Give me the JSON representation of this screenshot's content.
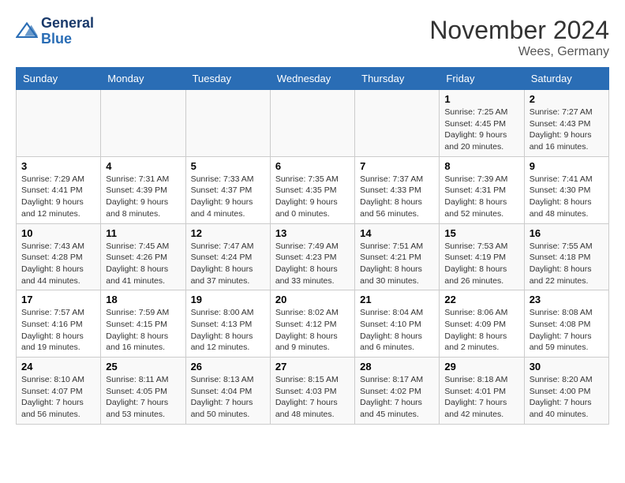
{
  "header": {
    "logo_line1": "General",
    "logo_line2": "Blue",
    "month": "November 2024",
    "location": "Wees, Germany"
  },
  "days_of_week": [
    "Sunday",
    "Monday",
    "Tuesday",
    "Wednesday",
    "Thursday",
    "Friday",
    "Saturday"
  ],
  "weeks": [
    [
      {
        "num": "",
        "info": ""
      },
      {
        "num": "",
        "info": ""
      },
      {
        "num": "",
        "info": ""
      },
      {
        "num": "",
        "info": ""
      },
      {
        "num": "",
        "info": ""
      },
      {
        "num": "1",
        "info": "Sunrise: 7:25 AM\nSunset: 4:45 PM\nDaylight: 9 hours and 20 minutes."
      },
      {
        "num": "2",
        "info": "Sunrise: 7:27 AM\nSunset: 4:43 PM\nDaylight: 9 hours and 16 minutes."
      }
    ],
    [
      {
        "num": "3",
        "info": "Sunrise: 7:29 AM\nSunset: 4:41 PM\nDaylight: 9 hours and 12 minutes."
      },
      {
        "num": "4",
        "info": "Sunrise: 7:31 AM\nSunset: 4:39 PM\nDaylight: 9 hours and 8 minutes."
      },
      {
        "num": "5",
        "info": "Sunrise: 7:33 AM\nSunset: 4:37 PM\nDaylight: 9 hours and 4 minutes."
      },
      {
        "num": "6",
        "info": "Sunrise: 7:35 AM\nSunset: 4:35 PM\nDaylight: 9 hours and 0 minutes."
      },
      {
        "num": "7",
        "info": "Sunrise: 7:37 AM\nSunset: 4:33 PM\nDaylight: 8 hours and 56 minutes."
      },
      {
        "num": "8",
        "info": "Sunrise: 7:39 AM\nSunset: 4:31 PM\nDaylight: 8 hours and 52 minutes."
      },
      {
        "num": "9",
        "info": "Sunrise: 7:41 AM\nSunset: 4:30 PM\nDaylight: 8 hours and 48 minutes."
      }
    ],
    [
      {
        "num": "10",
        "info": "Sunrise: 7:43 AM\nSunset: 4:28 PM\nDaylight: 8 hours and 44 minutes."
      },
      {
        "num": "11",
        "info": "Sunrise: 7:45 AM\nSunset: 4:26 PM\nDaylight: 8 hours and 41 minutes."
      },
      {
        "num": "12",
        "info": "Sunrise: 7:47 AM\nSunset: 4:24 PM\nDaylight: 8 hours and 37 minutes."
      },
      {
        "num": "13",
        "info": "Sunrise: 7:49 AM\nSunset: 4:23 PM\nDaylight: 8 hours and 33 minutes."
      },
      {
        "num": "14",
        "info": "Sunrise: 7:51 AM\nSunset: 4:21 PM\nDaylight: 8 hours and 30 minutes."
      },
      {
        "num": "15",
        "info": "Sunrise: 7:53 AM\nSunset: 4:19 PM\nDaylight: 8 hours and 26 minutes."
      },
      {
        "num": "16",
        "info": "Sunrise: 7:55 AM\nSunset: 4:18 PM\nDaylight: 8 hours and 22 minutes."
      }
    ],
    [
      {
        "num": "17",
        "info": "Sunrise: 7:57 AM\nSunset: 4:16 PM\nDaylight: 8 hours and 19 minutes."
      },
      {
        "num": "18",
        "info": "Sunrise: 7:59 AM\nSunset: 4:15 PM\nDaylight: 8 hours and 16 minutes."
      },
      {
        "num": "19",
        "info": "Sunrise: 8:00 AM\nSunset: 4:13 PM\nDaylight: 8 hours and 12 minutes."
      },
      {
        "num": "20",
        "info": "Sunrise: 8:02 AM\nSunset: 4:12 PM\nDaylight: 8 hours and 9 minutes."
      },
      {
        "num": "21",
        "info": "Sunrise: 8:04 AM\nSunset: 4:10 PM\nDaylight: 8 hours and 6 minutes."
      },
      {
        "num": "22",
        "info": "Sunrise: 8:06 AM\nSunset: 4:09 PM\nDaylight: 8 hours and 2 minutes."
      },
      {
        "num": "23",
        "info": "Sunrise: 8:08 AM\nSunset: 4:08 PM\nDaylight: 7 hours and 59 minutes."
      }
    ],
    [
      {
        "num": "24",
        "info": "Sunrise: 8:10 AM\nSunset: 4:07 PM\nDaylight: 7 hours and 56 minutes."
      },
      {
        "num": "25",
        "info": "Sunrise: 8:11 AM\nSunset: 4:05 PM\nDaylight: 7 hours and 53 minutes."
      },
      {
        "num": "26",
        "info": "Sunrise: 8:13 AM\nSunset: 4:04 PM\nDaylight: 7 hours and 50 minutes."
      },
      {
        "num": "27",
        "info": "Sunrise: 8:15 AM\nSunset: 4:03 PM\nDaylight: 7 hours and 48 minutes."
      },
      {
        "num": "28",
        "info": "Sunrise: 8:17 AM\nSunset: 4:02 PM\nDaylight: 7 hours and 45 minutes."
      },
      {
        "num": "29",
        "info": "Sunrise: 8:18 AM\nSunset: 4:01 PM\nDaylight: 7 hours and 42 minutes."
      },
      {
        "num": "30",
        "info": "Sunrise: 8:20 AM\nSunset: 4:00 PM\nDaylight: 7 hours and 40 minutes."
      }
    ]
  ]
}
